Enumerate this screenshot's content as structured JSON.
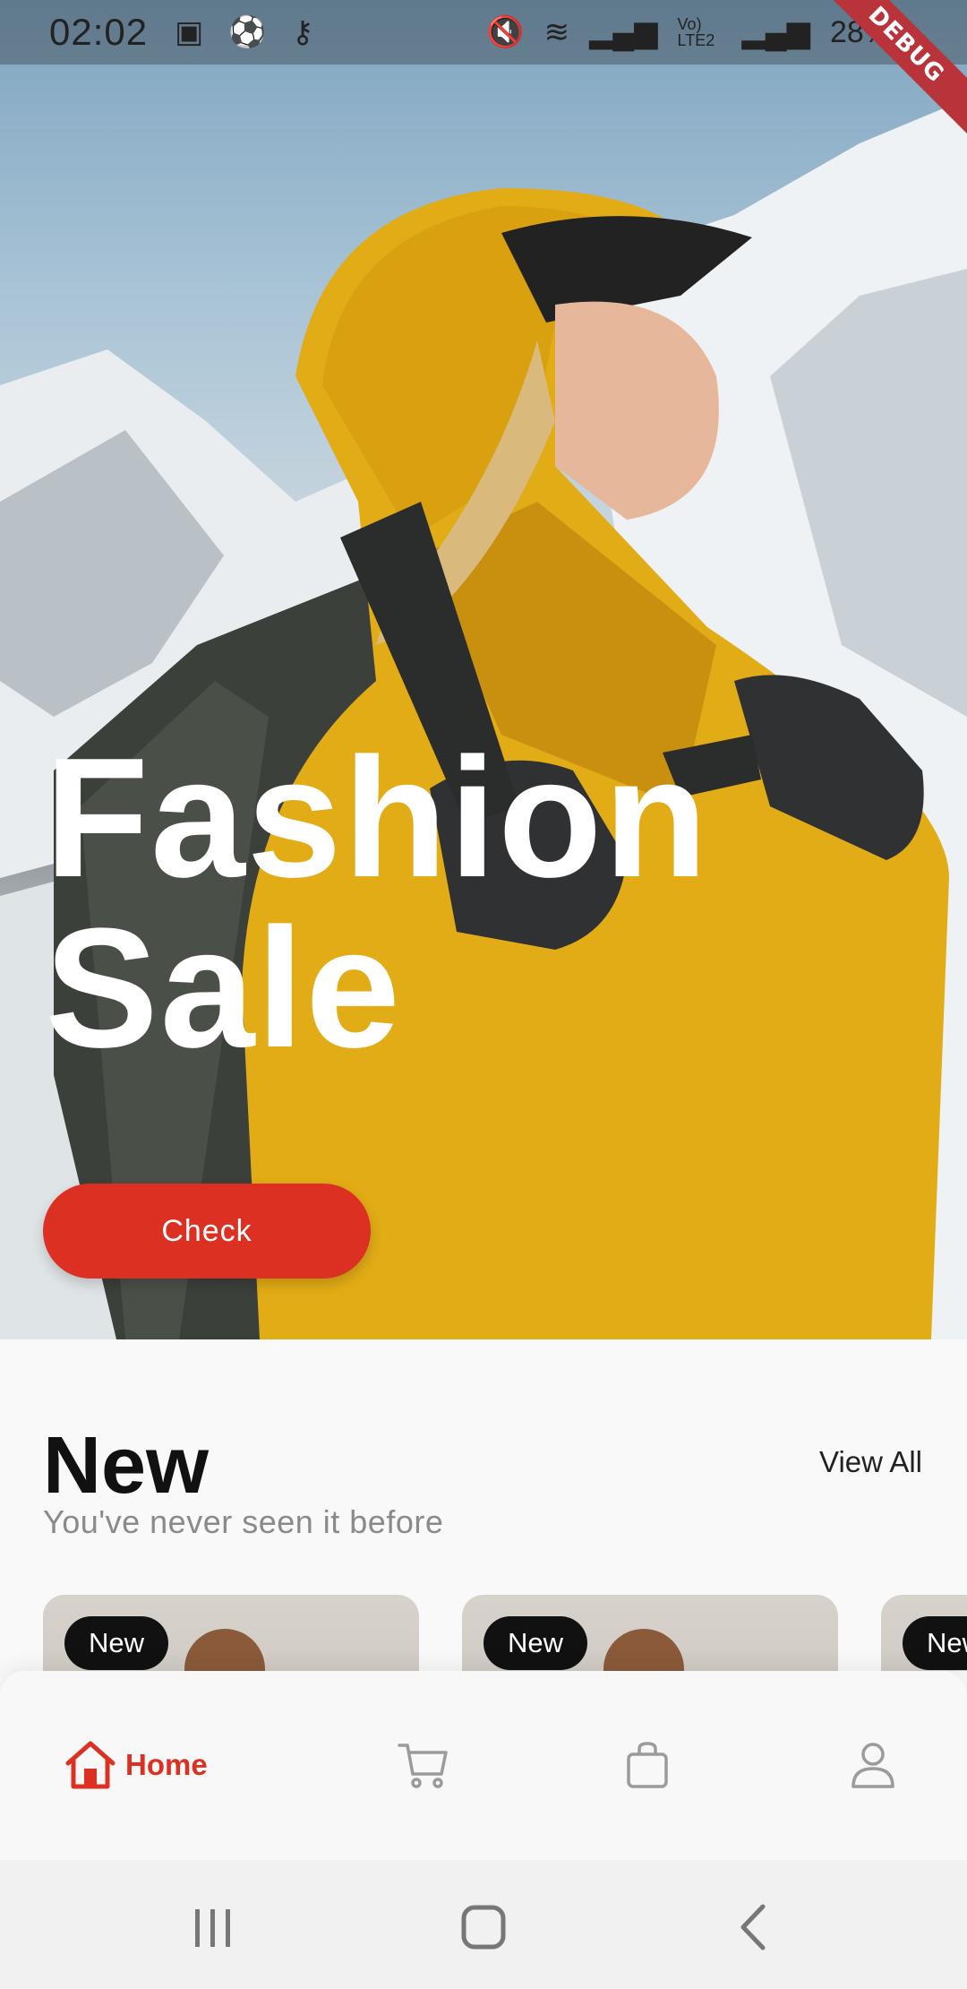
{
  "status_bar": {
    "time": "02:02",
    "battery_text": "28%",
    "lte_text": "Vo) LTE2",
    "left_icons": [
      "image-icon",
      "soccer-ball-icon",
      "key-icon"
    ],
    "right_icons": [
      "mute-icon",
      "wifi-icon",
      "signal-icon",
      "lte-icon",
      "signal-icon",
      "battery-icon"
    ]
  },
  "debug_banner": "DEBUG",
  "hero": {
    "title_line1": "Fashion",
    "title_line2": "Sale",
    "button_label": "Check"
  },
  "new_section": {
    "title": "New",
    "subtitle": "You've never seen it before",
    "view_all": "View All",
    "cards": [
      {
        "badge": "New"
      },
      {
        "badge": "New"
      },
      {
        "badge": "New"
      }
    ]
  },
  "bottom_nav": {
    "items": [
      {
        "label": "Home",
        "icon": "home-icon",
        "active": true
      },
      {
        "label": "",
        "icon": "cart-icon",
        "active": false
      },
      {
        "label": "",
        "icon": "bag-icon",
        "active": false
      },
      {
        "label": "",
        "icon": "profile-icon",
        "active": false
      }
    ]
  },
  "colors": {
    "accent": "#db3022",
    "background": "#f9f9f9",
    "badge": "#111111"
  }
}
